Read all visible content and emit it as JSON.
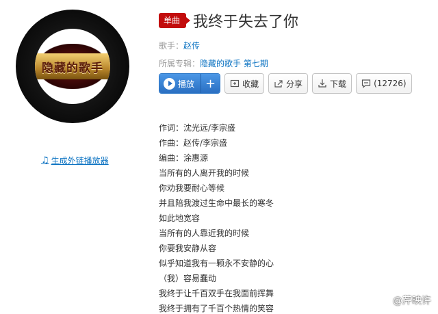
{
  "album_art": {
    "logo_text": "隐藏的歌手"
  },
  "external_player_link": "生成外链播放器",
  "song": {
    "badge": "单曲",
    "title": "我终于失去了你",
    "singer_label": "歌手：",
    "singer": "赵传",
    "album_label": "所属专辑：",
    "album": "隐藏的歌手 第七期"
  },
  "buttons": {
    "play": "播放",
    "add": "+",
    "collect": "收藏",
    "share": "分享",
    "download": "下载",
    "comments": "(12726)"
  },
  "lyrics": [
    "作词：沈光远/李宗盛",
    "作曲：赵传/李宗盛",
    "编曲：涂惠源",
    "当所有的人离开我的时候",
    "你劝我要耐心等候",
    "并且陪我渡过生命中最长的寒冬",
    "如此地宽容",
    "当所有的人靠近我的时候",
    "你要我安静从容",
    "似乎知道我有一颗永不安静的心",
    "（我）容易蠢动",
    "我终于让千百双手在我面前挥舞",
    "我终于拥有了千百个热情的笑容"
  ],
  "watermark": "@芹映许"
}
